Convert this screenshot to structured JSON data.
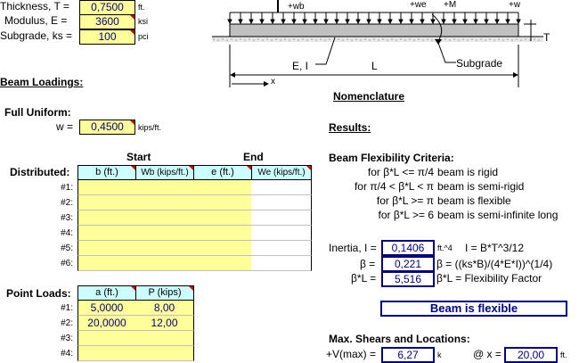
{
  "inputs": {
    "thickness_label": "Thickness, T =",
    "thickness_value": "0,7500",
    "thickness_unit": "ft.",
    "modulus_label": "Modulus, E =",
    "modulus_value": "3600",
    "modulus_unit": "ksi",
    "subgrade_label": "Subgrade, ks =",
    "subgrade_value": "100",
    "subgrade_unit": "pci"
  },
  "diagram": {
    "wb": "+wb",
    "we": "+we",
    "m": "+M",
    "w": "+w",
    "t": "T",
    "ei": "E, I",
    "l": "L",
    "subgrade": "Subgrade",
    "x": "x",
    "nomenclature": "Nomenclature"
  },
  "loadings": {
    "title": "Beam Loadings:",
    "full_uniform": "Full Uniform:",
    "w_label": "w =",
    "w_value": "0,4500",
    "w_unit": "kips/ft.",
    "start": "Start",
    "end": "End",
    "distributed": "Distributed:",
    "dist_headers": [
      "b (ft.)",
      "Wb (kips/ft.)",
      "e (ft.)",
      "We (kips/ft.)"
    ],
    "row_labels": [
      "#1:",
      "#2:",
      "#3:",
      "#4:",
      "#5:",
      "#6:"
    ],
    "point_loads": "Point Loads:",
    "point_headers": [
      "a (ft.)",
      "P (kips)"
    ],
    "point_rows": [
      {
        "num": "#1:",
        "a": "5,0000",
        "p": "8,00"
      },
      {
        "num": "#2:",
        "a": "20,0000",
        "p": "12,00"
      },
      {
        "num": "#3:",
        "a": "",
        "p": ""
      },
      {
        "num": "#4:",
        "a": "",
        "p": ""
      }
    ]
  },
  "results": {
    "title": "Results:",
    "criteria_title": "Beam Flexibility Criteria:",
    "criteria": [
      {
        "cond": "for β*L <= π/4",
        "desc": "beam is rigid"
      },
      {
        "cond": "for π/4 < β*L < π",
        "desc": "beam is semi-rigid"
      },
      {
        "cond": "for β*L >= π",
        "desc": "beam is flexible"
      },
      {
        "cond": "for β*L >= 6",
        "desc": "beam is semi-infinite long"
      }
    ],
    "inertia_label": "Inertia, I =",
    "inertia_value": "0,1406",
    "inertia_unit": "ft.^4",
    "inertia_formula": "I = B*T^3/12",
    "beta_label": "β =",
    "beta_value": "0,221",
    "beta_formula": "β = ((ks*B)/(4*E*I))^(1/4)",
    "bl_label": "β*L =",
    "bl_value": "5,516",
    "bl_formula": "β*L = Flexibility Factor",
    "status": "Beam is flexible",
    "shear_title": "Max. Shears and Locations:",
    "vmax_label": "+V(max) =",
    "vmax_value": "6,27",
    "vmax_unit": "k",
    "at_x_label": "@ x =",
    "at_x_value": "20,00",
    "at_x_unit": "ft."
  }
}
